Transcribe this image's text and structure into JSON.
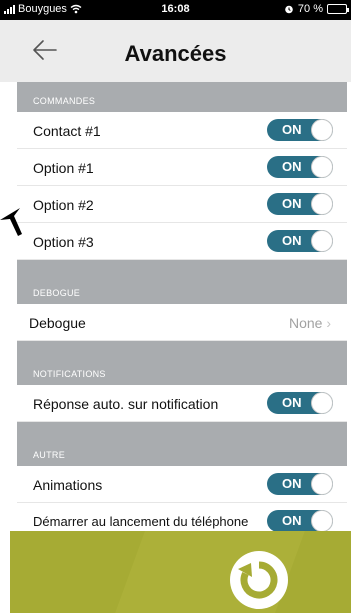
{
  "status_bar": {
    "carrier": "Bouygues",
    "time": "16:08",
    "battery": "70 %",
    "battery_level": 0.7
  },
  "nav": {
    "title": "Avancées",
    "back_icon": "back-arrow-icon"
  },
  "sections": {
    "commandes": {
      "header": "COMMANDES",
      "items": [
        {
          "label": "Contact #1",
          "state": "ON"
        },
        {
          "label": "Option #1",
          "state": "ON"
        },
        {
          "label": "Option #2",
          "state": "ON"
        },
        {
          "label": "Option #3",
          "state": "ON"
        }
      ]
    },
    "debogue": {
      "header": "DEBOGUE",
      "item": {
        "label": "Debogue",
        "value": "None"
      }
    },
    "notifications": {
      "header": "NOTIFICATIONS",
      "item": {
        "label": "Réponse auto. sur notification",
        "state": "ON"
      }
    },
    "autre": {
      "header": "AUTRE",
      "items": [
        {
          "label": "Animations",
          "state": "ON"
        },
        {
          "label": "Démarrer au lancement du téléphone",
          "state": "ON"
        }
      ]
    }
  },
  "footer": {
    "reset_icon": "reset-icon"
  },
  "colors": {
    "toggle_on": "#2a6f86",
    "section_header": "#a9acaf",
    "footer": "#a6ab34",
    "navbar": "#ececec"
  }
}
